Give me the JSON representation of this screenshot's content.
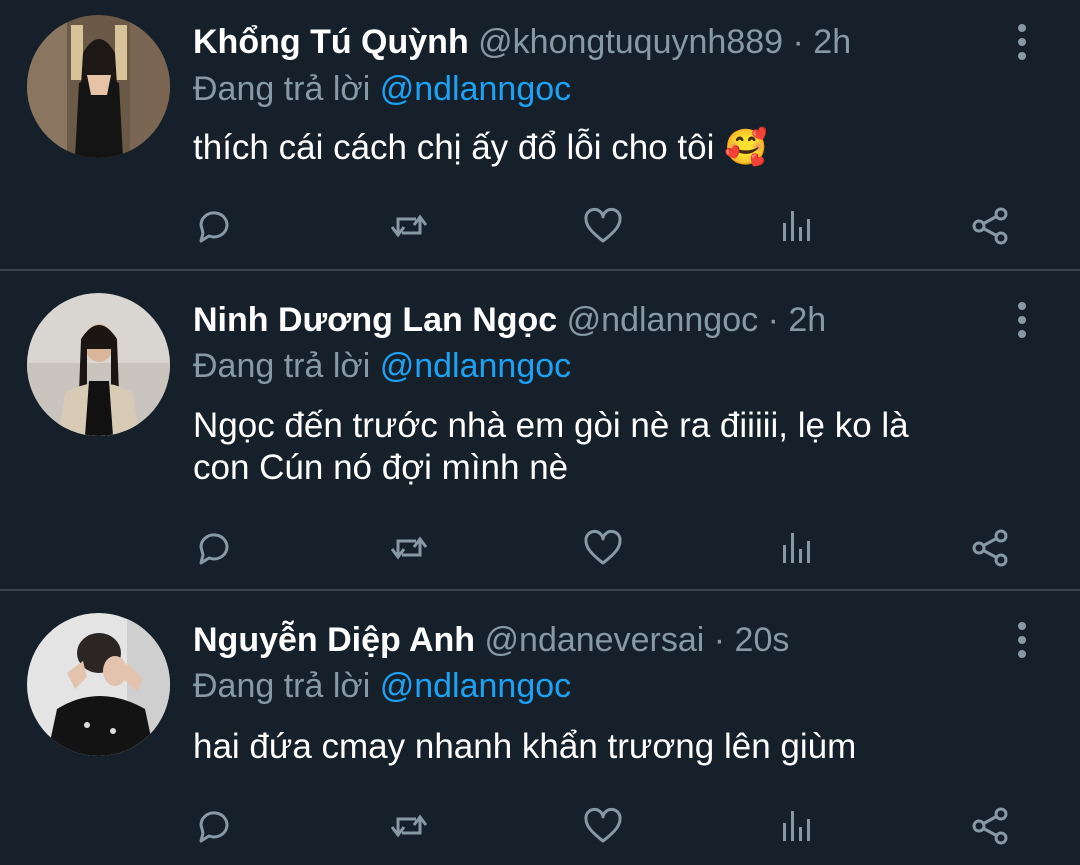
{
  "colors": {
    "background": "#15202b",
    "divider": "#38444d",
    "secondary_text": "#8899a6",
    "link": "#1da1f2"
  },
  "tweets": [
    {
      "author_name": "Khổng Tú Quỳnh",
      "handle": "@khongtuquynh889",
      "separator": "·",
      "time": "2h",
      "replying_label": "Đang trả lời",
      "replying_to": "@ndlanngoc",
      "text_lines": [
        "thích cái cách chị ấy đổ lỗi cho tôi 🥰"
      ]
    },
    {
      "author_name": "Ninh Dương Lan Ngọc",
      "handle": "@ndlanngoc",
      "separator": "·",
      "time": "2h",
      "replying_label": "Đang trả lời",
      "replying_to": "@ndlanngoc",
      "text_lines": [
        "Ngọc đến trước nhà em gòi nè ra điiiii, lẹ ko là",
        "con Cún nó đợi mình nè"
      ]
    },
    {
      "author_name": "Nguyễn Diệp Anh",
      "handle": "@ndaneversai",
      "separator": "·",
      "time": "20s",
      "replying_label": "Đang trả lời",
      "replying_to": "@ndlanngoc",
      "text_lines": [
        "hai đứa cmay nhanh khẩn trương lên giùm"
      ]
    }
  ],
  "action_icons": [
    "reply-icon",
    "retweet-icon",
    "like-icon",
    "analytics-icon",
    "share-icon"
  ]
}
